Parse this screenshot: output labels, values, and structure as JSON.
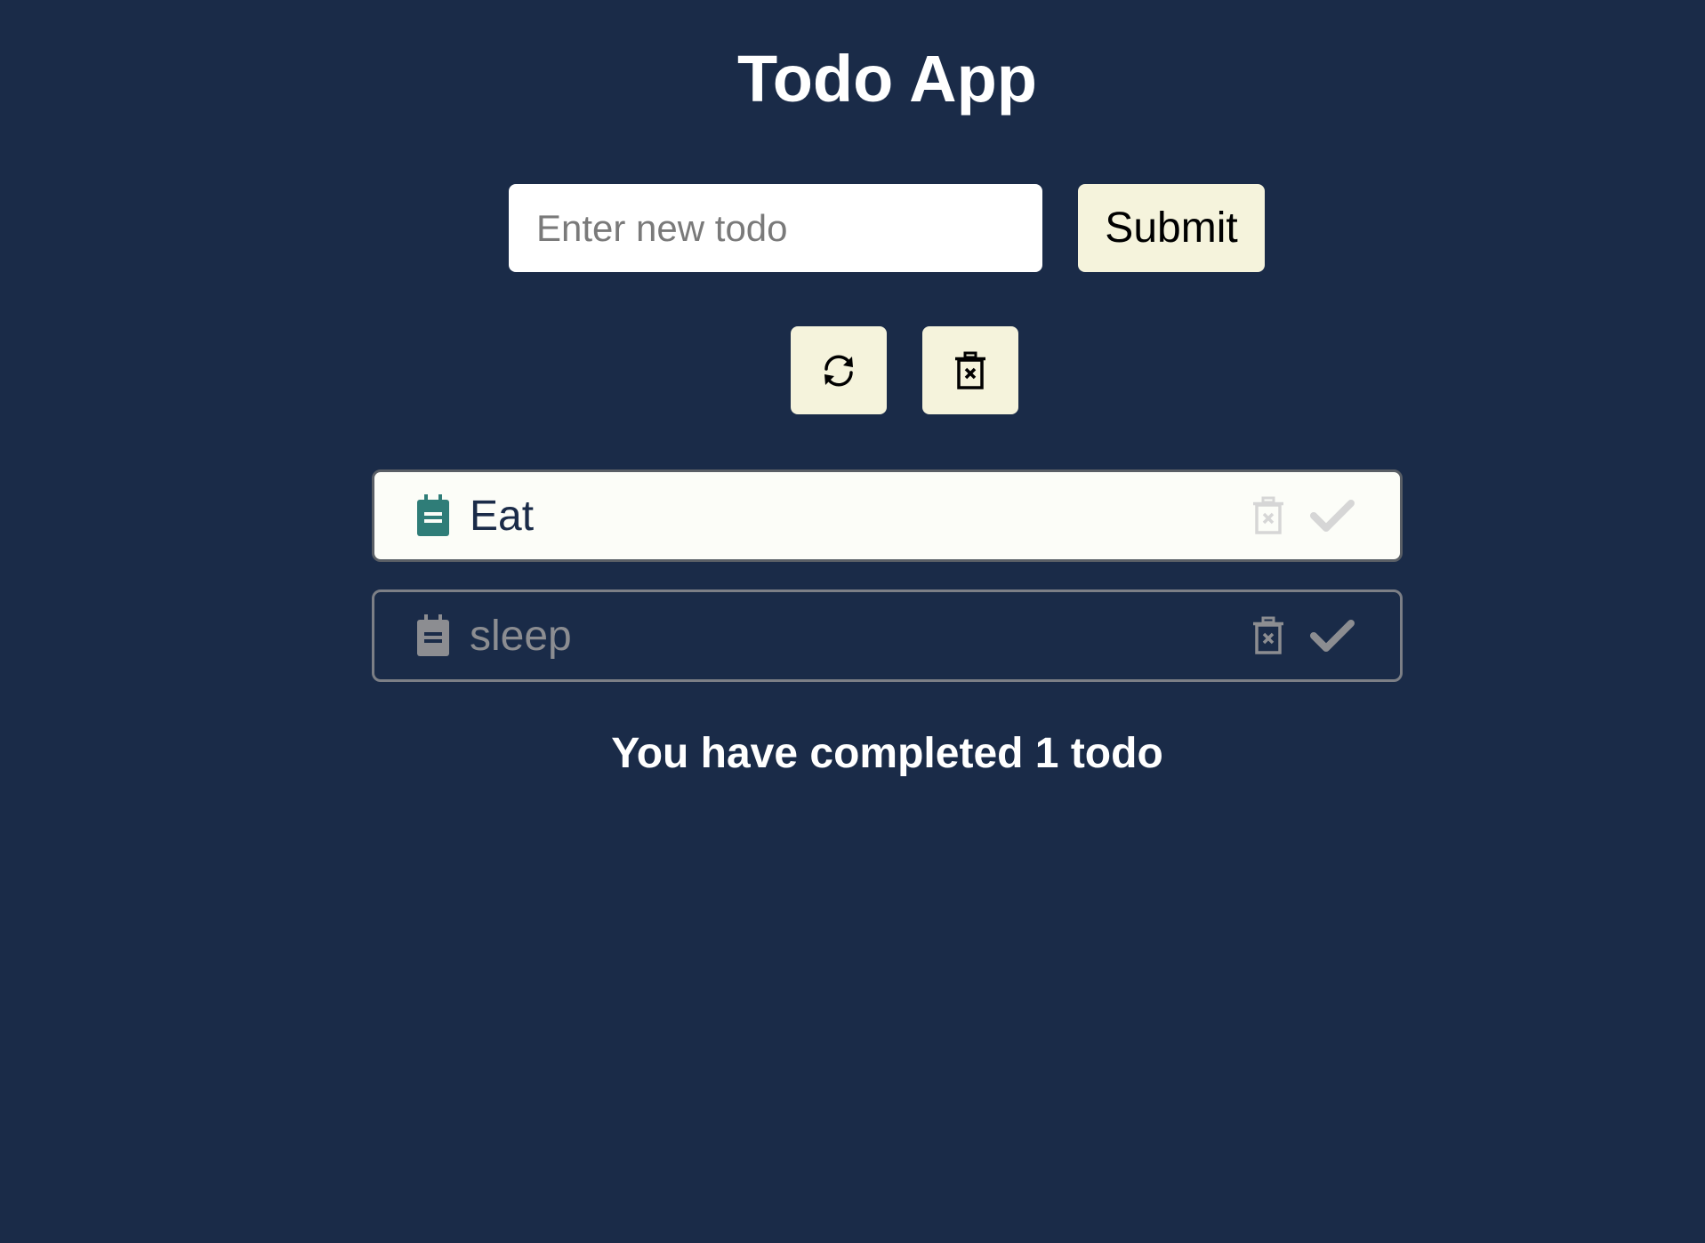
{
  "app": {
    "title": "Todo App"
  },
  "form": {
    "input_value": "",
    "input_placeholder": "Enter new todo",
    "submit_label": "Submit"
  },
  "controls": {
    "refresh_icon": "refresh-icon",
    "clear_icon": "trash-x-icon"
  },
  "todos": [
    {
      "text": "Eat",
      "completed": false,
      "icon": "clipboard-icon"
    },
    {
      "text": "sleep",
      "completed": true,
      "icon": "clipboard-icon"
    }
  ],
  "status": {
    "text": "You have completed 1 todo"
  },
  "colors": {
    "background": "#1a2b48",
    "button_bg": "#f5f3dc",
    "active_item_bg": "#fcfdf8",
    "accent_teal": "#2f7d78",
    "muted_gray": "#8c8d91"
  }
}
